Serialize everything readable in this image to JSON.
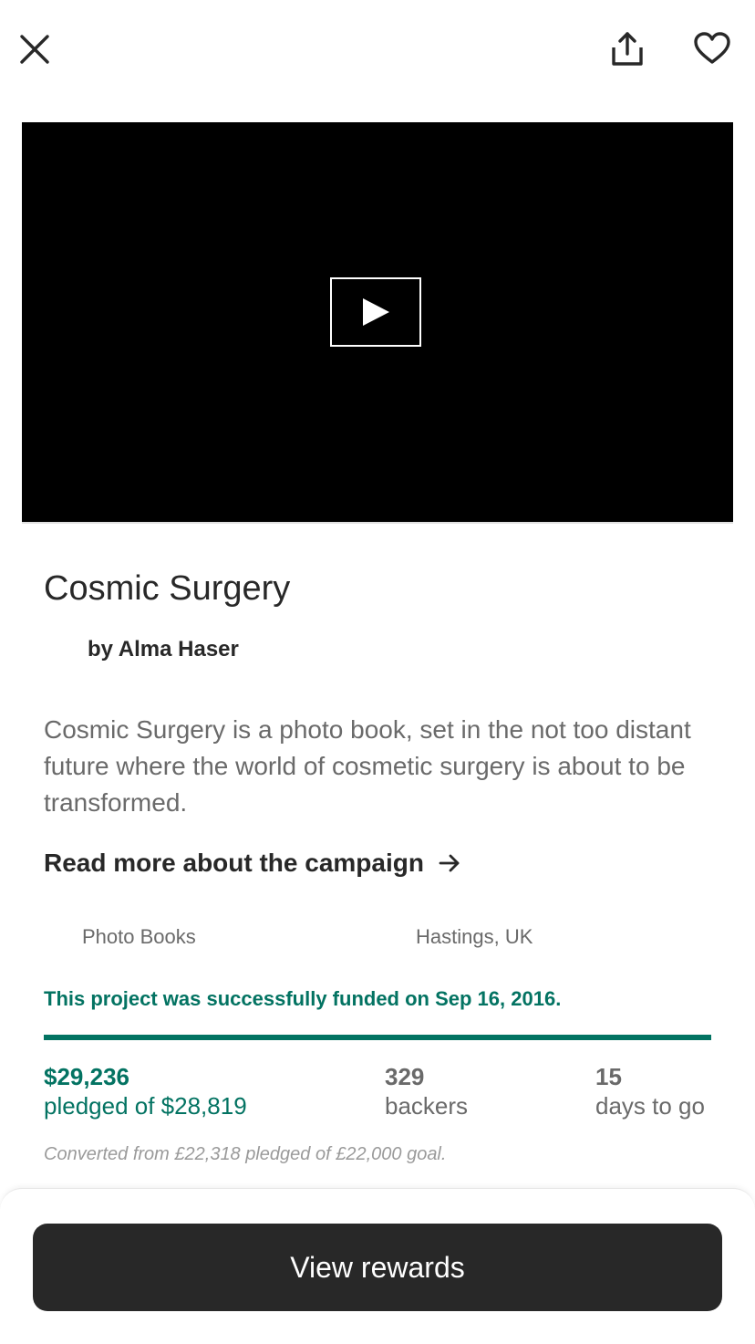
{
  "header": {
    "close_icon": "close-icon",
    "share_icon": "share-icon",
    "save_icon": "heart-icon"
  },
  "video": {
    "play_icon": "play-icon"
  },
  "project": {
    "title": "Cosmic Surgery",
    "creator": "by Alma Haser",
    "blurb": "Cosmic Surgery is a photo book, set in the not too distant future where the world of cosmetic surgery is about to be transformed.",
    "read_more_label": "Read more about the campaign",
    "category": "Photo Books",
    "location": "Hastings, UK"
  },
  "funding": {
    "status_note": "This project was successfully funded on Sep 16, 2016.",
    "progress_percent": 100,
    "pledged_amount": "$29,236",
    "pledged_label": "pledged of $28,819",
    "backers_count": "329",
    "backers_label": "backers",
    "days_count": "15",
    "days_label": "days to go",
    "conversion_note": "Converted from £22,318 pledged of £22,000 goal."
  },
  "footer": {
    "rewards_button_label": "View rewards"
  },
  "colors": {
    "accent": "#037362",
    "text_primary": "#282828",
    "text_secondary": "#6a6a6a",
    "button_bg": "#282828"
  }
}
